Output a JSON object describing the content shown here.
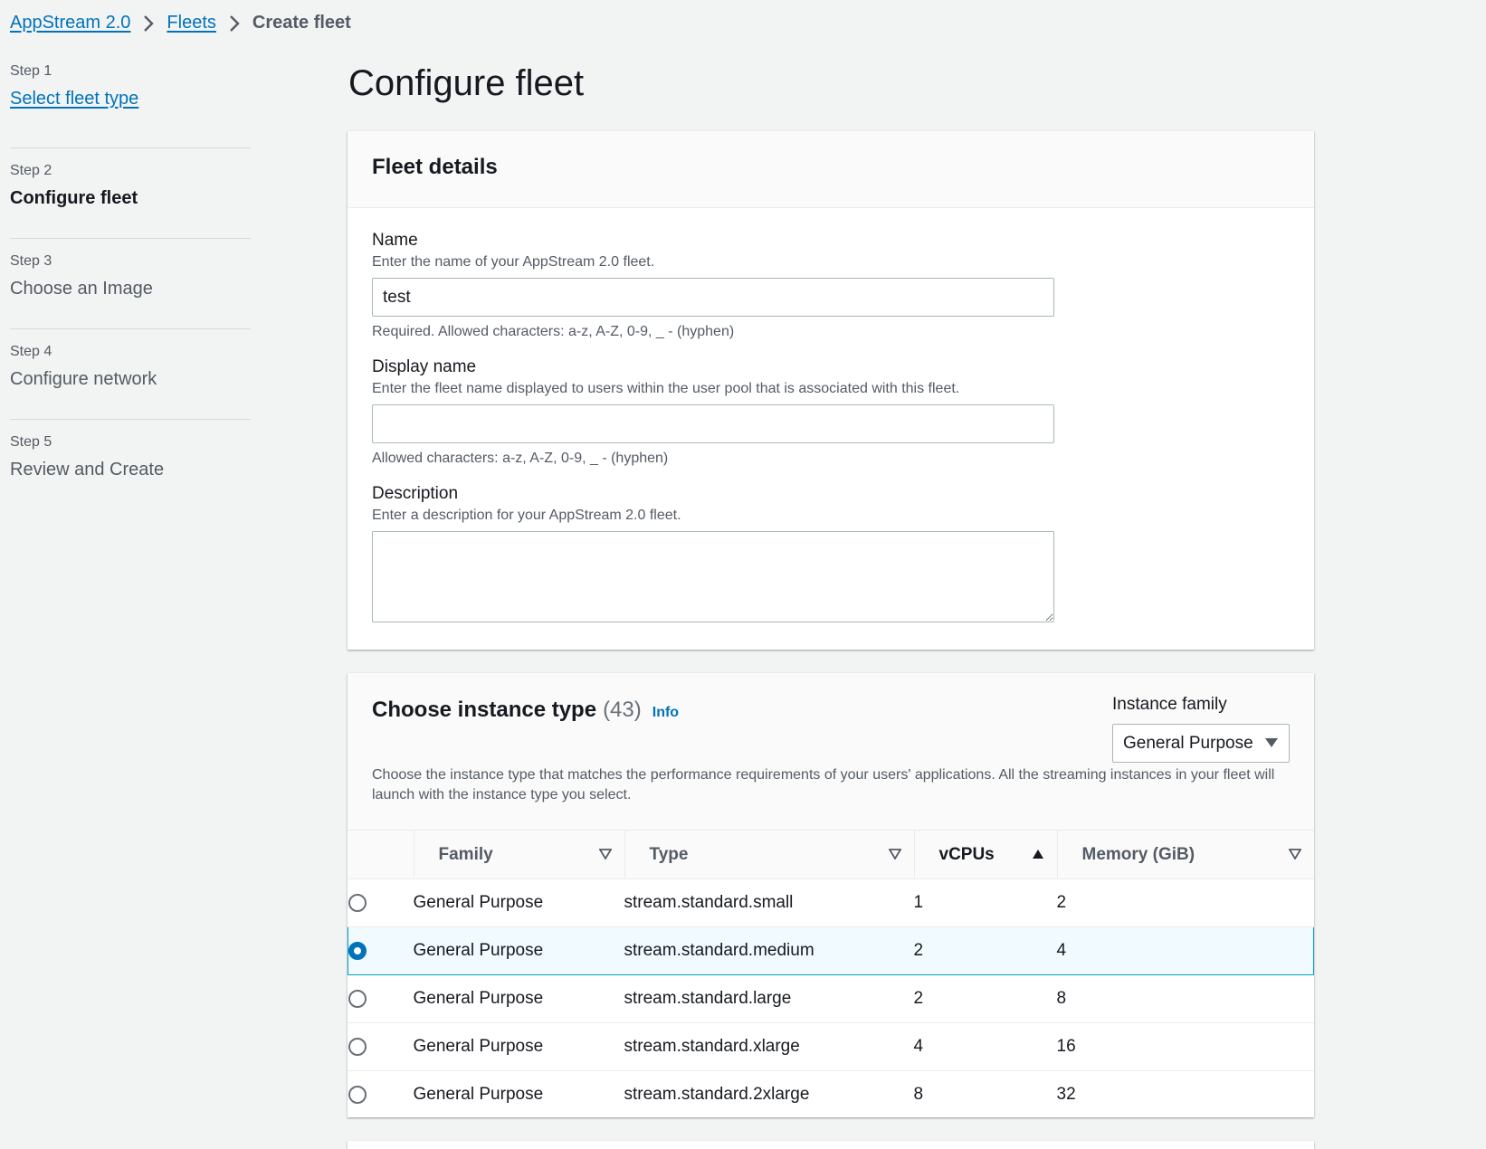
{
  "breadcrumb": {
    "items": [
      {
        "label": "AppStream 2.0"
      },
      {
        "label": "Fleets"
      },
      {
        "label": "Create fleet"
      }
    ]
  },
  "steps": [
    {
      "num": "Step 1",
      "label": "Select fleet type"
    },
    {
      "num": "Step 2",
      "label": "Configure fleet"
    },
    {
      "num": "Step 3",
      "label": "Choose an Image"
    },
    {
      "num": "Step 4",
      "label": "Configure network"
    },
    {
      "num": "Step 5",
      "label": "Review and Create"
    }
  ],
  "page_title": "Configure fleet",
  "fleet_details": {
    "title": "Fleet details",
    "name": {
      "label": "Name",
      "description": "Enter the name of your AppStream 2.0 fleet.",
      "value": "test",
      "constraint": "Required. Allowed characters: a-z, A-Z, 0-9, _ - (hyphen)"
    },
    "display_name": {
      "label": "Display name",
      "description": "Enter the fleet name displayed to users within the user pool that is associated with this fleet.",
      "value": "",
      "constraint": "Allowed characters: a-z, A-Z, 0-9, _ - (hyphen)"
    },
    "description": {
      "label": "Description",
      "description": "Enter a description for your AppStream 2.0 fleet.",
      "value": ""
    }
  },
  "instance_type": {
    "title": "Choose instance type",
    "count": "(43)",
    "info_label": "Info",
    "family_filter": {
      "label": "Instance family",
      "value": "General Purpose"
    },
    "description": "Choose the instance type that matches the performance requirements of your users' applications. All the streaming instances in your fleet will launch with the instance type you select.",
    "columns": [
      "Family",
      "Type",
      "vCPUs",
      "Memory (GiB)"
    ],
    "sort_column": "vCPUs",
    "sort_direction": "ascending",
    "rows": [
      {
        "family": "General Purpose",
        "type": "stream.standard.small",
        "vcpus": "1",
        "memory": "2",
        "selected": false
      },
      {
        "family": "General Purpose",
        "type": "stream.standard.medium",
        "vcpus": "2",
        "memory": "4",
        "selected": true
      },
      {
        "family": "General Purpose",
        "type": "stream.standard.large",
        "vcpus": "2",
        "memory": "8",
        "selected": false
      },
      {
        "family": "General Purpose",
        "type": "stream.standard.xlarge",
        "vcpus": "4",
        "memory": "16",
        "selected": false
      },
      {
        "family": "General Purpose",
        "type": "stream.standard.2xlarge",
        "vcpus": "8",
        "memory": "32",
        "selected": false
      }
    ]
  },
  "colors": {
    "link": "#0073bb",
    "page_bg": "#f2f3f3",
    "selected_row_bg": "#f1faff",
    "selected_row_border": "#00a1c9"
  }
}
